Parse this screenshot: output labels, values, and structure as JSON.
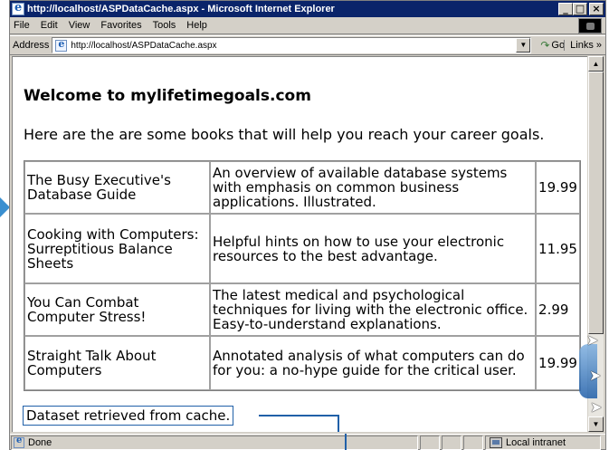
{
  "window": {
    "title": "http://localhost/ASPDataCache.aspx - Microsoft Internet Explorer",
    "controls": {
      "minimize": "_",
      "maximize": "□",
      "close": "×"
    }
  },
  "menu": {
    "items": [
      "File",
      "Edit",
      "View",
      "Favorites",
      "Tools",
      "Help"
    ]
  },
  "address": {
    "label": "Address",
    "url": "http://localhost/ASPDataCache.aspx",
    "go_label": "Go",
    "links_label": "Links »"
  },
  "page": {
    "heading": "Welcome to mylifetimegoals.com",
    "intro": "Here are the are some books that will help you reach your career goals.",
    "books": [
      {
        "title": "The Busy Executive's Database Guide",
        "description": "An overview of available database systems with emphasis on common business applications. Illustrated.",
        "price": "19.99"
      },
      {
        "title": "Cooking with Computers: Surreptitious Balance Sheets",
        "description": "Helpful hints on how to use your electronic resources to the best advantage.",
        "price": "11.95"
      },
      {
        "title": "You Can Combat Computer Stress!",
        "description": "The latest medical and psychological techniques for living with the electronic office. Easy-to-understand explanations.",
        "price": "2.99"
      },
      {
        "title": "Straight Talk About Computers",
        "description": "Annotated analysis of what computers can do for you: a no-hype guide for the critical user.",
        "price": "19.99"
      }
    ],
    "status_message": "Dataset retrieved from cache."
  },
  "statusbar": {
    "status": "Done",
    "zone": "Local intranet"
  },
  "colors": {
    "titlebar": "#0a246a",
    "chrome": "#d4d0c8",
    "callout": "#2060a8"
  }
}
